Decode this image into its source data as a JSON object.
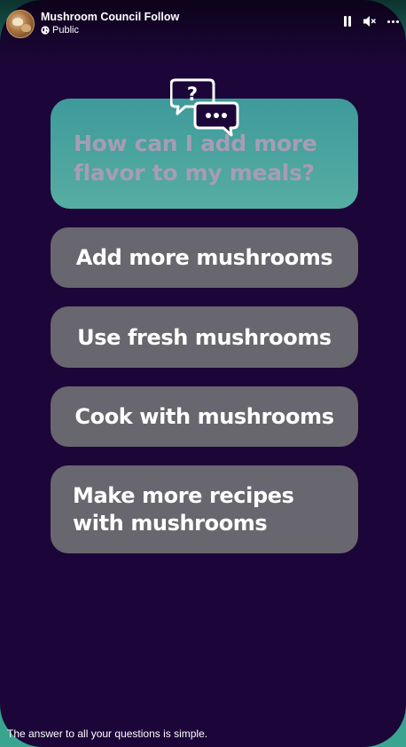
{
  "header": {
    "page_name": "Mushroom Council Follow",
    "privacy": "Public",
    "icons": [
      "avatar",
      "globe-icon",
      "pause-icon",
      "volume-muted-icon",
      "more-options-icon"
    ]
  },
  "story": {
    "question": "How can I add more flavor to my meals?",
    "question_icon": "chat-bubbles-question-icon",
    "answers": [
      "Add more mushrooms",
      "Use fresh mushrooms",
      "Cook with mushrooms",
      "Make more recipes with mushrooms"
    ]
  },
  "caption": "The answer to all your questions is simple.",
  "colors": {
    "background": "#1c0639",
    "question_card": "#4aa39e",
    "answer_card": "#68666e",
    "question_text": "#a79cb6",
    "edge_accent": "#2c8a7e"
  }
}
